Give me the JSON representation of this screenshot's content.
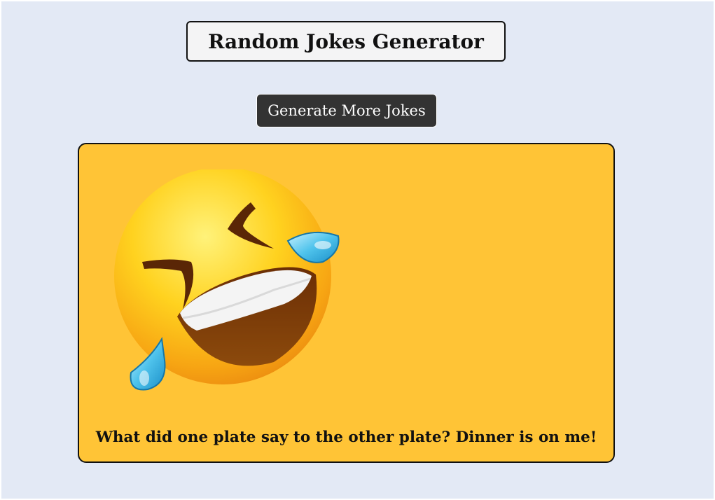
{
  "header": {
    "title": "Random Jokes Generator"
  },
  "controls": {
    "generate_label": "Generate More Jokes"
  },
  "joke": {
    "text": "What did one plate say to the other plate? Dinner is on me!",
    "icon": "rolling-on-floor-laughing-emoji"
  },
  "colors": {
    "page_background": "#e3e9f5",
    "card_background": "#ffc436",
    "button_background": "#333333",
    "title_background": "#f4f4f5"
  }
}
